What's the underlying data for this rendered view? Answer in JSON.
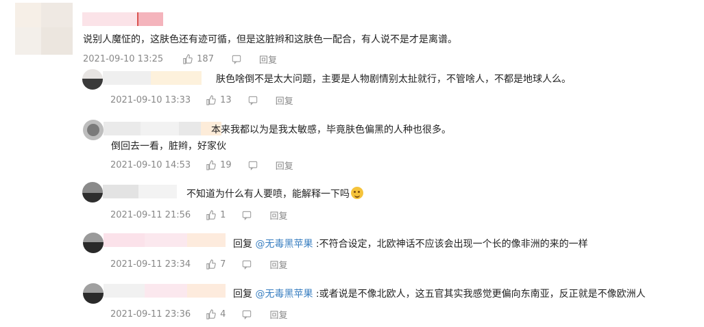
{
  "main_comment": {
    "text": "说别人魔怔的，这肤色还有迹可循，但是这脏辫和这肤色一配合，有人说不是才是离谱。",
    "timestamp": "2021-09-10 13:25",
    "likes": "187",
    "reply_label": "回复"
  },
  "replies": [
    {
      "text": "肤色啥倒不是太大问题，主要是人物剧情别太扯就行，不管啥人，不都是地球人么。",
      "timestamp": "2021-09-10 13:33",
      "likes": "13",
      "reply_label": "回复"
    },
    {
      "text_line1": "本来我都以为是我太敏感，毕竟肤色偏黑的人种也很多。",
      "text_line2": "倒回去一看，脏辫，好家伙",
      "timestamp": "2021-09-10 14:53",
      "likes": "19",
      "reply_label": "回复"
    },
    {
      "text": "不知道为什么有人要喷，能解释一下吗",
      "timestamp": "2021-09-11 21:56",
      "likes": "1",
      "reply_label": "回复",
      "emoji": "grinning-face-icon"
    },
    {
      "reply_prefix": "回复",
      "mention": "@无毒黑苹果",
      "text": ":不符合设定，北欧神话不应该会出现一个长的像非洲的来的一样",
      "timestamp": "2021-09-11 23:34",
      "likes": "7",
      "reply_label": "回复"
    },
    {
      "reply_prefix": "回复",
      "mention": "@无毒黑苹果",
      "text": ":或者说是不像北欧人，这五官其实我感觉更偏向东南亚，反正就是不像欧洲人",
      "timestamp": "2021-09-11 23:36",
      "likes": "4",
      "reply_label": "回复"
    }
  ],
  "colors": {
    "mention": "#3a7fc1",
    "meta": "#888888",
    "text": "#222222"
  }
}
